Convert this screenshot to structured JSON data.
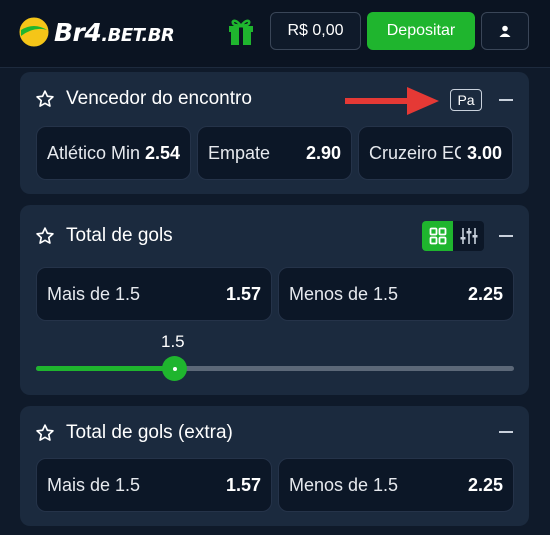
{
  "header": {
    "logo_main": "Br4",
    "logo_suffix": ".BET.BR",
    "balance": "R$ 0,00",
    "deposit_label": "Depositar"
  },
  "markets": [
    {
      "title": "Vencedor do encontro",
      "badge": "Pa",
      "outcomes": [
        {
          "label": "Atlético Mineiro",
          "odd": "2.54"
        },
        {
          "label": "Empate",
          "odd": "2.90"
        },
        {
          "label": "Cruzeiro EC",
          "odd": "3.00"
        }
      ]
    },
    {
      "title": "Total de gols",
      "outcomes": [
        {
          "label": "Mais de 1.5",
          "odd": "1.57"
        },
        {
          "label": "Menos de 1.5",
          "odd": "2.25"
        }
      ],
      "slider": {
        "label": "1.5",
        "fill_fraction": 0.288
      }
    },
    {
      "title": "Total de gols (extra)",
      "outcomes": [
        {
          "label": "Mais de 1.5",
          "odd": "1.57"
        },
        {
          "label": "Menos de 1.5",
          "odd": "2.25"
        }
      ]
    }
  ],
  "colors": {
    "accent_green": "#1fb52e",
    "card_bg": "#1b2a3e",
    "page_bg": "#0f1a2a",
    "arrow_red": "#e53935"
  }
}
